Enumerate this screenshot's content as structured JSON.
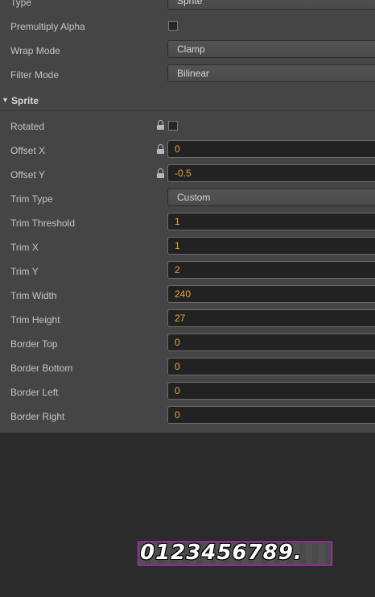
{
  "texture": {
    "type_label": "Type",
    "type_value": "Sprite",
    "premultiply_label": "Premultiply Alpha",
    "wrap_label": "Wrap Mode",
    "wrap_value": "Clamp",
    "filter_label": "Filter Mode",
    "filter_value": "Bilinear"
  },
  "sprite": {
    "section_title": "Sprite",
    "rotated_label": "Rotated",
    "offset_x_label": "Offset X",
    "offset_x_value": "0",
    "offset_y_label": "Offset Y",
    "offset_y_value": "-0.5",
    "trim_type_label": "Trim Type",
    "trim_type_value": "Custom",
    "trim_threshold_label": "Trim Threshold",
    "trim_threshold_value": "1",
    "trim_x_label": "Trim X",
    "trim_x_value": "1",
    "trim_y_label": "Trim Y",
    "trim_y_value": "2",
    "trim_width_label": "Trim Width",
    "trim_width_value": "240",
    "trim_height_label": "Trim Height",
    "trim_height_value": "27",
    "border_top_label": "Border Top",
    "border_top_value": "0",
    "border_bottom_label": "Border Bottom",
    "border_bottom_value": "0",
    "border_left_label": "Border Left",
    "border_left_value": "0",
    "border_right_label": "Border Right",
    "border_right_value": "0"
  },
  "preview": {
    "text": "0123456789."
  }
}
